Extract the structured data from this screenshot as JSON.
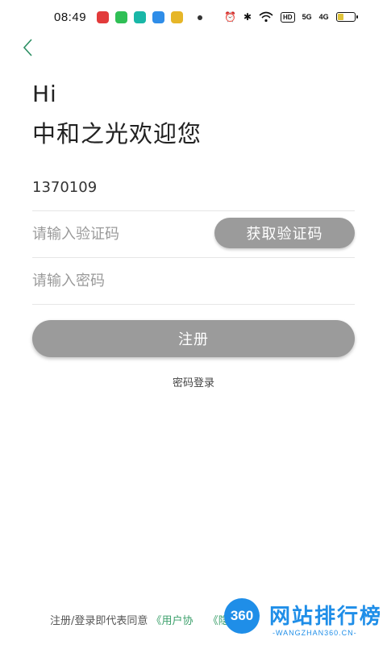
{
  "status_bar": {
    "time": "08:49",
    "hd_label": "HD",
    "signal_1": "5G",
    "signal_2": "4G",
    "battery_level": 0.4,
    "app_icon_colors": [
      "#e23b3b",
      "#2fbf55",
      "#19b7a7",
      "#2f8de8",
      "#e6b628"
    ]
  },
  "header": {
    "back_icon": "chevron-left-icon",
    "accent_color": "#2c8f63"
  },
  "greeting": {
    "line1": "Hi",
    "line2": "中和之光欢迎您"
  },
  "form": {
    "phone_value": "1370109",
    "code_placeholder": "请输入验证码",
    "get_code_label": "获取验证码",
    "password_placeholder": "请输入密码",
    "register_label": "注册",
    "password_login_label": "密码登录"
  },
  "footer": {
    "agreement_prefix": "注册/登录即代表同意",
    "user_agreement_link": "《用户协",
    "privacy_link_partial": "《隐私政"
  },
  "watermark": {
    "badge": "360",
    "title": "网站排行榜",
    "subtitle": "-WANGZHAN360.CN-"
  },
  "colors": {
    "button_gray": "#9b9b9b",
    "link_green": "#3a9f6a",
    "watermark_blue": "#1f8ee8"
  }
}
